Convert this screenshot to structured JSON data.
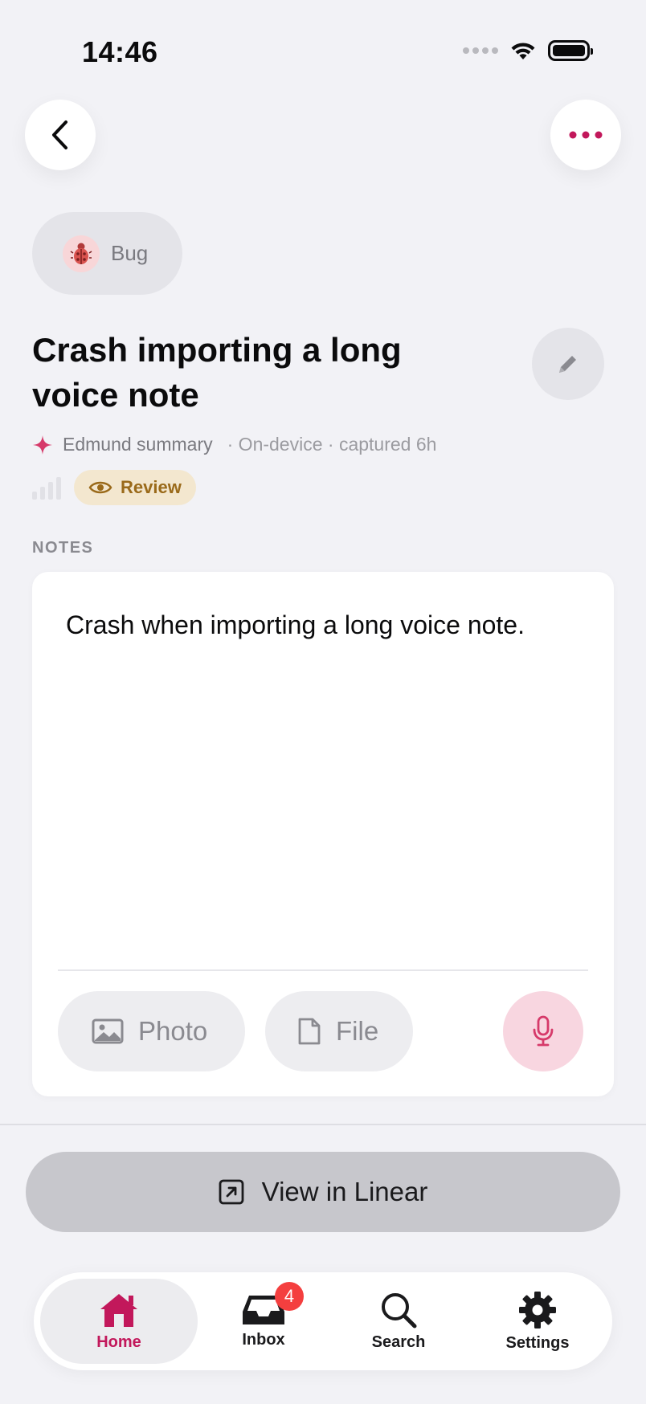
{
  "status_bar": {
    "time": "14:46"
  },
  "header": {
    "back_icon": "chevron-left-icon",
    "more_icon": "ellipsis-icon"
  },
  "issue": {
    "type_label": "Bug",
    "type_icon": "ladybug-icon",
    "title": "Crash importing a long voice note",
    "summary_label": "Edmund summary",
    "meta_extra": "· On-device · captured 6h",
    "status_label": "Review"
  },
  "notes": {
    "section_label": "NOTES",
    "text": "Crash when importing a long voice note.",
    "photo_label": "Photo",
    "file_label": "File"
  },
  "actions": {
    "view_in_linear_label": "View in Linear"
  },
  "tabbar": {
    "items": [
      {
        "label": "Home",
        "icon": "house-icon",
        "active": true
      },
      {
        "label": "Inbox",
        "icon": "inbox-tray-icon",
        "badge": "4"
      },
      {
        "label": "Search",
        "icon": "magnifier-icon"
      },
      {
        "label": "Settings",
        "icon": "gear-icon"
      }
    ]
  },
  "colors": {
    "accent": "#c2185b",
    "background": "#f2f2f6",
    "review_bg": "#f3e7cf",
    "review_text": "#9a6a1a",
    "badge": "#f43f3f"
  }
}
